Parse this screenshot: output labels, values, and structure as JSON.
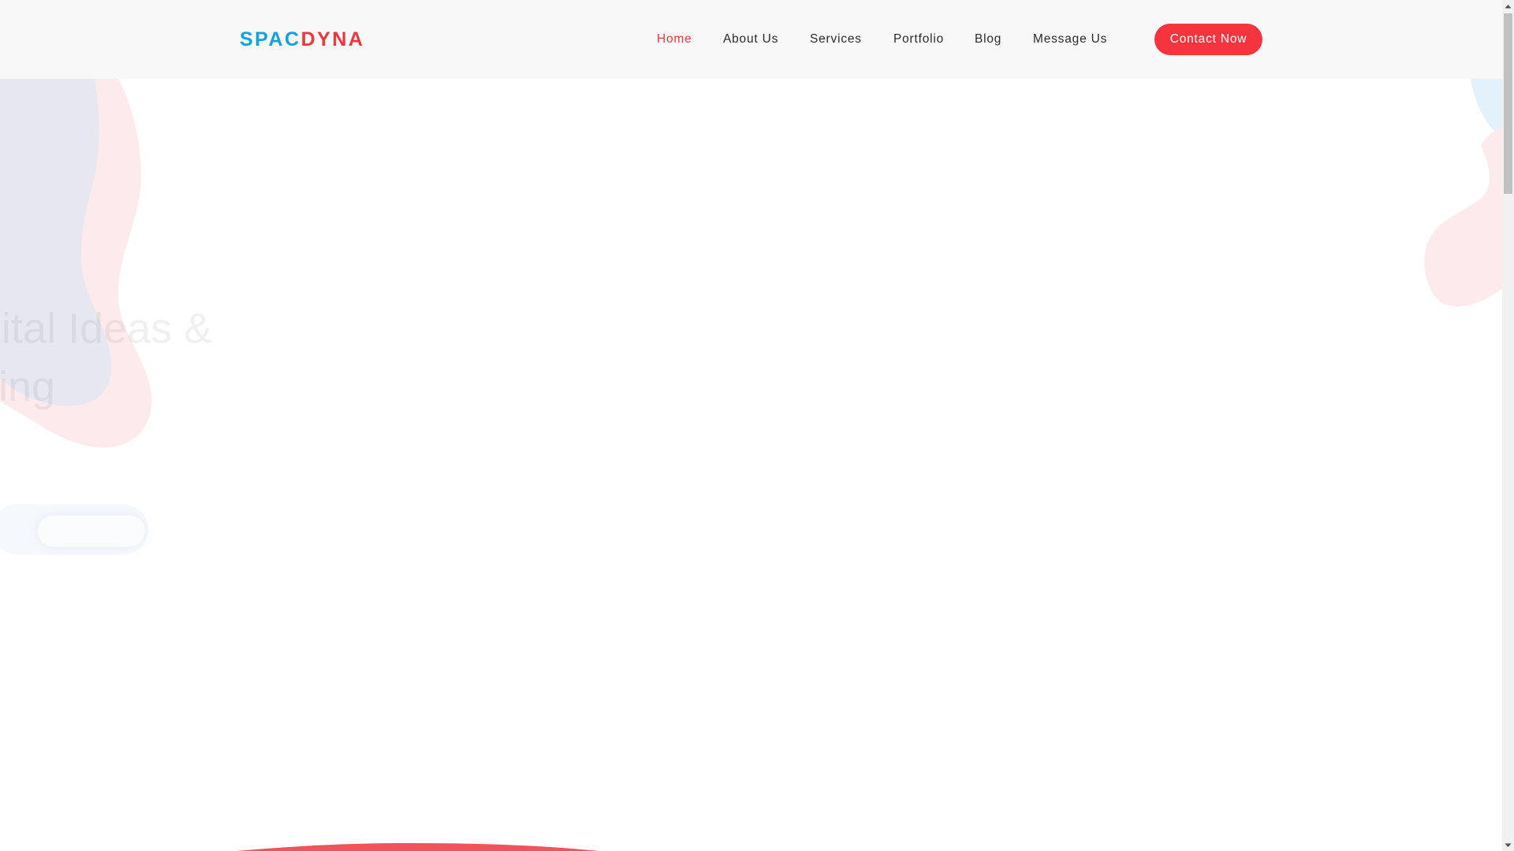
{
  "brand": {
    "logo_part1": "SPAC",
    "logo_part2": "DYNA",
    "color_primary": "#0fa3e4",
    "color_accent": "#f0353f"
  },
  "nav": {
    "items": [
      {
        "label": "Home",
        "active": true
      },
      {
        "label": "About Us",
        "active": false
      },
      {
        "label": "Services",
        "active": false
      },
      {
        "label": "Portfolio",
        "active": false
      },
      {
        "label": "Blog",
        "active": false
      },
      {
        "label": "Message Us",
        "active": false
      }
    ],
    "cta_label": "Contact Now"
  },
  "hero": {
    "title_line1": "gital Ideas &",
    "title_line2": "ing"
  },
  "colors": {
    "header_bg": "#f8f8f8",
    "button_bg": "#f5343d",
    "blob_pink": "#fdeaec",
    "blob_gray": "#e6e7ef",
    "blob_blue": "#e3f1fb",
    "arc_red": "#f0535a"
  },
  "icons": [
    "scroll-up-arrow-icon",
    "scroll-down-arrow-icon"
  ]
}
